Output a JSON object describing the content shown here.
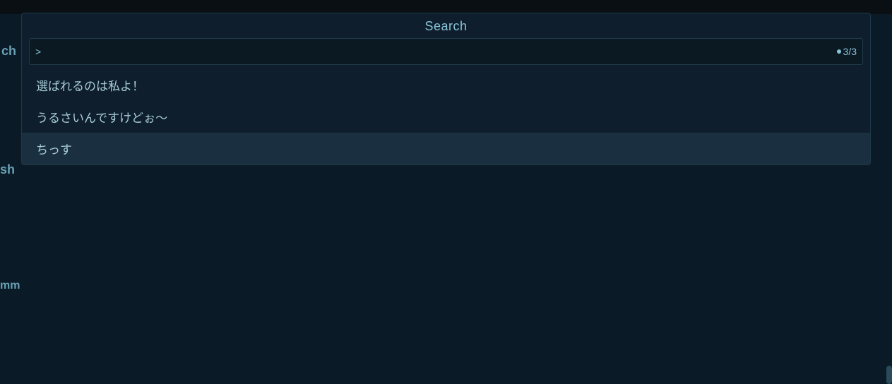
{
  "topBar": {
    "bgColor": "#0a0f14"
  },
  "searchDialog": {
    "title": "Search",
    "inputValue": "",
    "inputPlaceholder": "",
    "chevron": ">",
    "counter": "3/3",
    "counterDot": "•"
  },
  "results": [
    {
      "text": "選ばれるのは私よ！",
      "selected": false
    },
    {
      "text": "うるさいんですけどぉ〜",
      "selected": false
    },
    {
      "text": "ちっす",
      "selected": true
    }
  ],
  "leftEdge": {
    "topText": "ch",
    "midText": "sh",
    "bottomText": "mm"
  }
}
